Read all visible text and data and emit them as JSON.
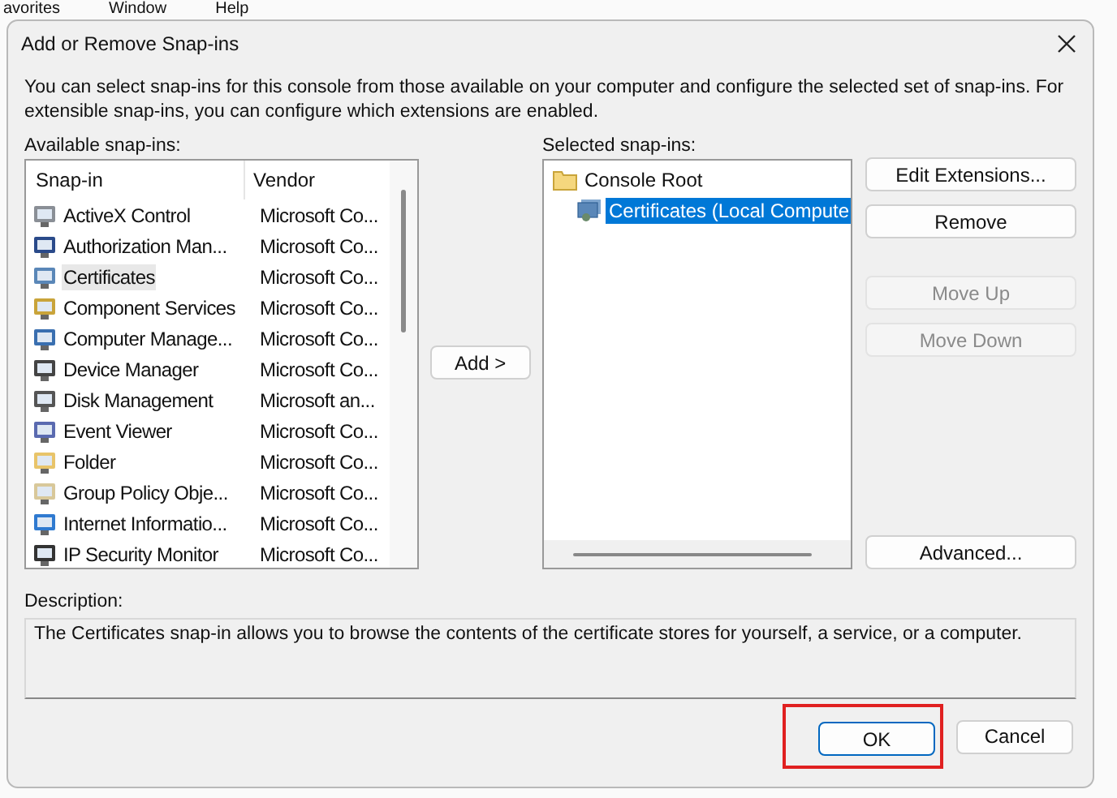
{
  "background_menu": [
    "avorites",
    "Window",
    "Help"
  ],
  "window": {
    "title": "Add or Remove Snap-ins"
  },
  "intro": "You can select snap-ins for this console from those available on your computer and configure the selected set of snap-ins. For extensible snap-ins, you can configure which extensions are enabled.",
  "available": {
    "label": "Available snap-ins:",
    "columns": [
      "Snap-in",
      "Vendor"
    ],
    "rows": [
      {
        "name": "ActiveX Control",
        "vendor": "Microsoft Co...",
        "selected": false
      },
      {
        "name": "Authorization Man...",
        "vendor": "Microsoft Co...",
        "selected": false
      },
      {
        "name": "Certificates",
        "vendor": "Microsoft Co...",
        "selected": true
      },
      {
        "name": "Component Services",
        "vendor": "Microsoft Co...",
        "selected": false
      },
      {
        "name": "Computer Manage...",
        "vendor": "Microsoft Co...",
        "selected": false
      },
      {
        "name": "Device Manager",
        "vendor": "Microsoft Co...",
        "selected": false
      },
      {
        "name": "Disk Management",
        "vendor": "Microsoft an...",
        "selected": false
      },
      {
        "name": "Event Viewer",
        "vendor": "Microsoft Co...",
        "selected": false
      },
      {
        "name": "Folder",
        "vendor": "Microsoft Co...",
        "selected": false
      },
      {
        "name": "Group Policy Obje...",
        "vendor": "Microsoft Co...",
        "selected": false
      },
      {
        "name": "Internet Informatio...",
        "vendor": "Microsoft Co...",
        "selected": false
      },
      {
        "name": "IP Security Monitor",
        "vendor": "Microsoft Co...",
        "selected": false
      }
    ]
  },
  "add_button": "Add >",
  "selected": {
    "label": "Selected snap-ins:",
    "tree": [
      {
        "label": "Console Root",
        "selected": false,
        "children": [
          {
            "label": "Certificates (Local Compute",
            "selected": true
          }
        ]
      }
    ]
  },
  "side_buttons": [
    {
      "label": "Edit Extensions...",
      "disabled": false
    },
    {
      "label": "Remove",
      "disabled": false
    },
    {
      "label": "Move Up",
      "disabled": true
    },
    {
      "label": "Move Down",
      "disabled": true
    },
    {
      "label": "Advanced...",
      "disabled": false
    }
  ],
  "description": {
    "label": "Description:",
    "text": "The Certificates snap-in allows you to browse the contents of the certificate stores for yourself, a service, or a computer."
  },
  "footer_buttons": [
    {
      "label": "OK",
      "default": true,
      "highlighted": true
    },
    {
      "label": "Cancel",
      "default": false,
      "highlighted": false
    }
  ]
}
